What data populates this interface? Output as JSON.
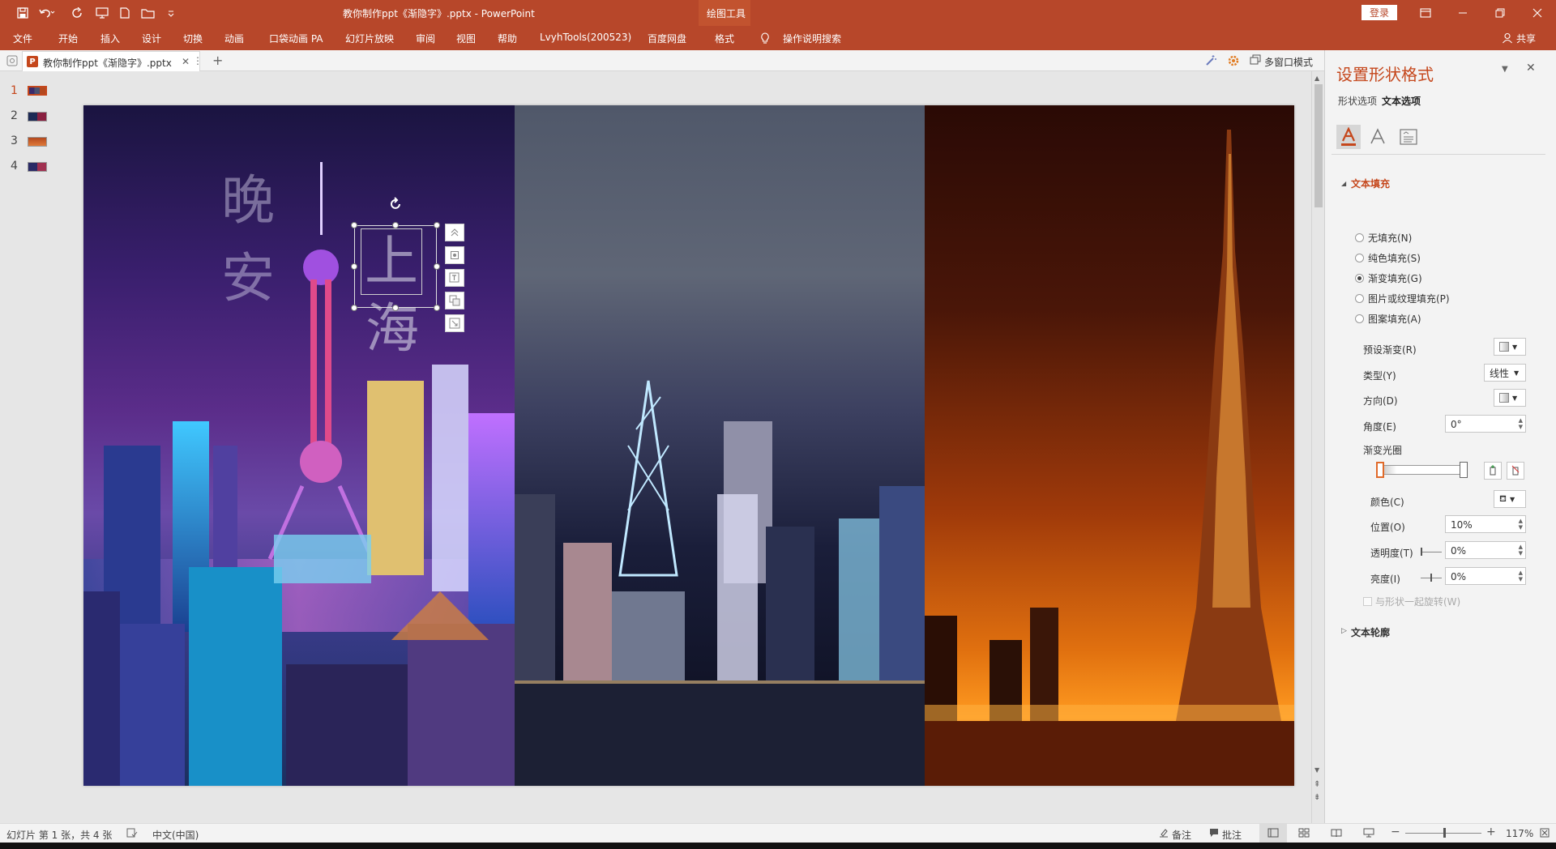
{
  "app": {
    "title": "教你制作ppt《渐隐字》.pptx  -  PowerPoint",
    "context_tab": "绘图工具",
    "login": "登录"
  },
  "ribbon": {
    "tabs": [
      "文件",
      "开始",
      "插入",
      "设计",
      "切换",
      "动画",
      "口袋动画 PA",
      "幻灯片放映",
      "审阅",
      "视图",
      "帮助",
      "LvyhTools(200523)",
      "百度网盘",
      "格式"
    ],
    "search": "操作说明搜索",
    "share": "共享"
  },
  "doc_tab": {
    "name": "教你制作ppt《渐隐字》.pptx",
    "multiwindow": "多窗口模式"
  },
  "thumbnails": [
    {
      "num": "1",
      "color": "#3a2a6a"
    },
    {
      "num": "2",
      "color": "#1d2a55"
    },
    {
      "num": "3",
      "color": "#b3481e"
    },
    {
      "num": "4",
      "color": "#2a2a66"
    }
  ],
  "slide": {
    "text_wan": "晚",
    "text_an": "安",
    "text_shang": "上",
    "text_hai": "海"
  },
  "pane": {
    "title": "设置形状格式",
    "tab_shape": "形状选项",
    "tab_text": "文本选项",
    "section_fill": "文本填充",
    "fill_options": [
      "无填充(N)",
      "纯色填充(S)",
      "渐变填充(G)",
      "图片或纹理填充(P)",
      "图案填充(A)"
    ],
    "fill_selected_index": 2,
    "preset_label": "预设渐变(R)",
    "type_label": "类型(Y)",
    "type_value": "线性",
    "direction_label": "方向(D)",
    "angle_label": "角度(E)",
    "angle_value": "0°",
    "gradient_stops_label": "渐变光圈",
    "color_label": "颜色(C)",
    "position_label": "位置(O)",
    "position_value": "10%",
    "transparency_label": "透明度(T)",
    "transparency_value": "0%",
    "brightness_label": "亮度(I)",
    "brightness_value": "0%",
    "rotate_with_shape": "与形状一起旋转(W)",
    "section_outline": "文本轮廓"
  },
  "status": {
    "slide_info": "幻灯片 第 1 张，共 4 张",
    "language": "中文(中国)",
    "notes": "备注",
    "comments": "批注",
    "zoom": "117%"
  },
  "colors": {
    "brand": "#b7472a",
    "accent": "#c5471c"
  }
}
